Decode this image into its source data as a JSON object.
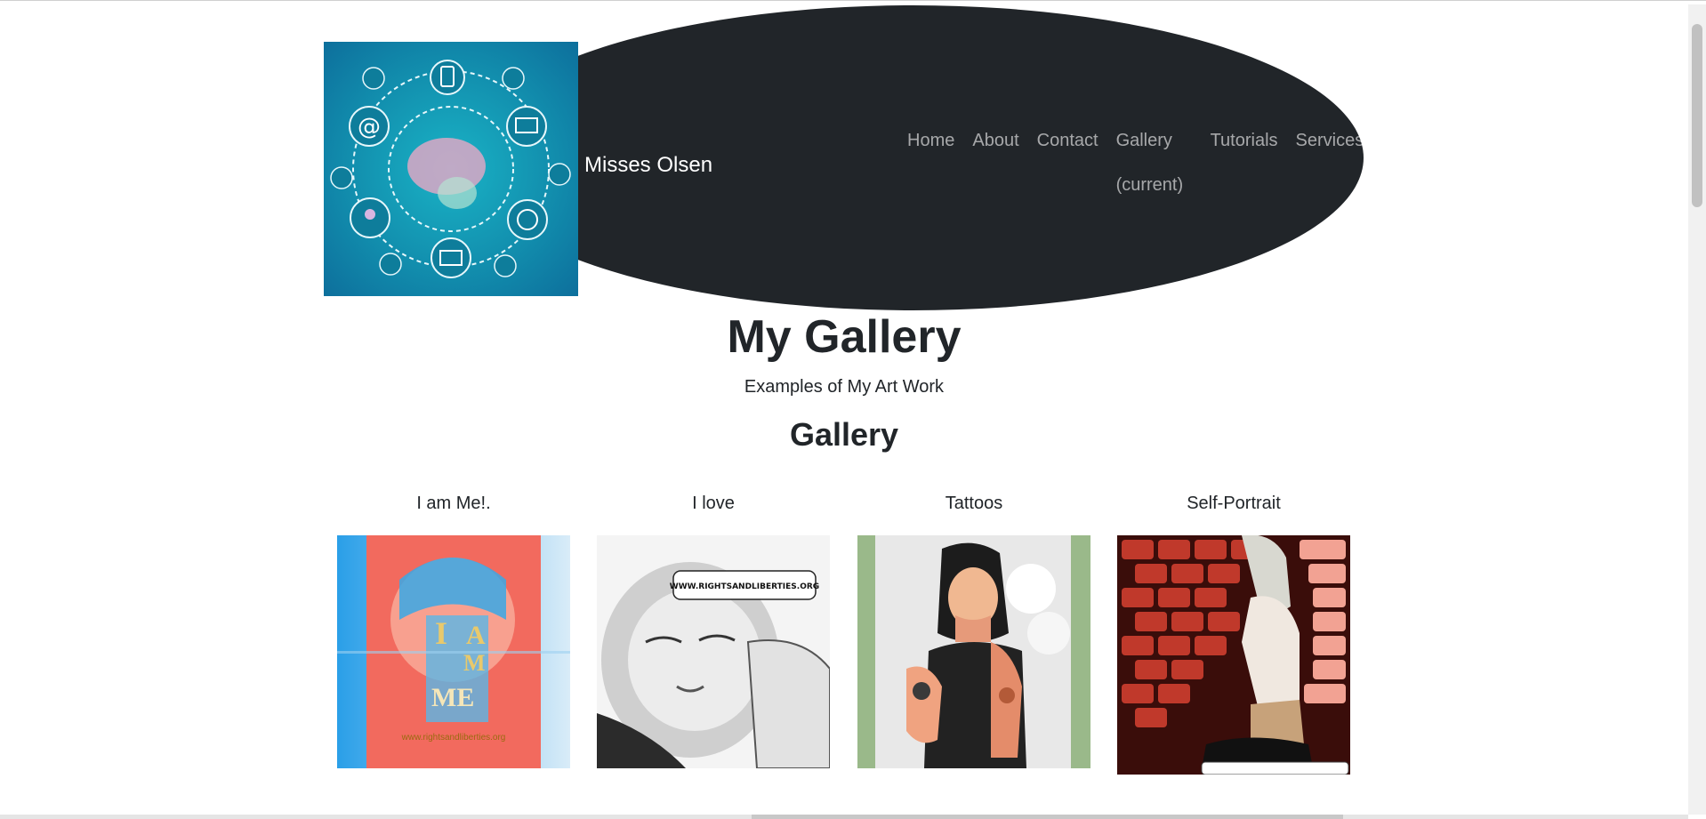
{
  "navbar": {
    "brand": "Misses Olsen",
    "links": [
      {
        "label": "Home"
      },
      {
        "label": "About"
      },
      {
        "label": "Contact"
      },
      {
        "label": "Gallery (current)"
      },
      {
        "label": "Tutorials"
      },
      {
        "label": "Services"
      }
    ]
  },
  "hero": {
    "title": "My Gallery",
    "subtitle": "Examples of My Art Work"
  },
  "gallery": {
    "title": "Gallery",
    "items": [
      {
        "caption": "I am Me!.",
        "image_text": "I AM ME",
        "image_footer": "www.rightsandliberties.org"
      },
      {
        "caption": "I love",
        "image_text": "WWW.RIGHTSANDLIBERTIES.ORG"
      },
      {
        "caption": "Tattoos"
      },
      {
        "caption": "Self-Portrait"
      }
    ]
  },
  "colors": {
    "nav_bg": "#212529",
    "nav_link": "rgba(255,255,255,0.6)",
    "brand": "#ffffff",
    "text": "#212529"
  }
}
